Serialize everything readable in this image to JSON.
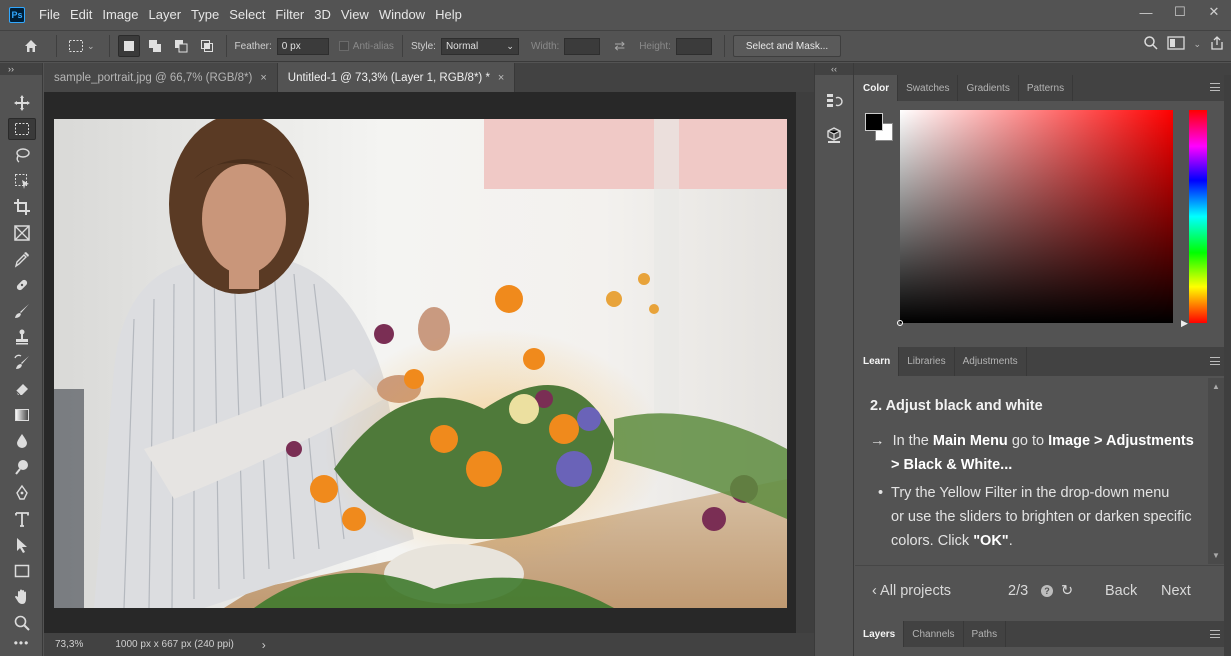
{
  "app": {
    "logo_text": "Ps"
  },
  "menu": [
    "File",
    "Edit",
    "Image",
    "Layer",
    "Type",
    "Select",
    "Filter",
    "3D",
    "View",
    "Window",
    "Help"
  ],
  "window_controls": {
    "minimize": "—",
    "maximize": "☐",
    "close": "✕"
  },
  "options": {
    "feather_label": "Feather:",
    "feather_value": "0 px",
    "antialias_label": "Anti-alias",
    "style_label": "Style:",
    "style_value": "Normal",
    "width_label": "Width:",
    "height_label": "Height:",
    "select_mask_label": "Select and Mask..."
  },
  "tabs": [
    {
      "label": "sample_portrait.jpg @ 66,7% (RGB/8*)",
      "close": "×"
    },
    {
      "label": "Untitled-1 @ 73,3% (Layer 1, RGB/8*) *",
      "close": "×"
    }
  ],
  "status": {
    "zoom": "73,3%",
    "doc_info": "1000 px x 667 px (240 ppi)",
    "arrow": "›"
  },
  "panel_collapse": "‹‹",
  "toolbar_collapse": "››",
  "color_panel": {
    "tabs": [
      "Color",
      "Swatches",
      "Gradients",
      "Patterns"
    ],
    "foreground": "#000000",
    "background": "#ffffff",
    "hue": "#ff0000"
  },
  "learn_panel": {
    "tabs": [
      "Learn",
      "Libraries",
      "Adjustments"
    ],
    "step_title": "2.  Adjust black and white",
    "bullet_arrow": "→",
    "line1_pre": "In the ",
    "line1_b1": "Main Menu",
    "line1_mid": " go to ",
    "line1_b2": "Image > Adjustments",
    "line2_b": "> Black & White...",
    "bullet_dot": "•",
    "line3": "Try the Yellow Filter in the drop-down menu",
    "line4": "or use the sliders to brighten or darken specific",
    "line5_pre": "colors. Click ",
    "line5_b": "\"OK\"",
    "line5_post": ".",
    "footer_back_projects": "‹ All projects",
    "footer_progress": "2/3",
    "footer_help": "?",
    "footer_reset": "↻",
    "footer_back": "Back",
    "footer_next": "Next"
  },
  "bottom_panel": {
    "tabs": [
      "Layers",
      "Channels",
      "Paths"
    ]
  }
}
